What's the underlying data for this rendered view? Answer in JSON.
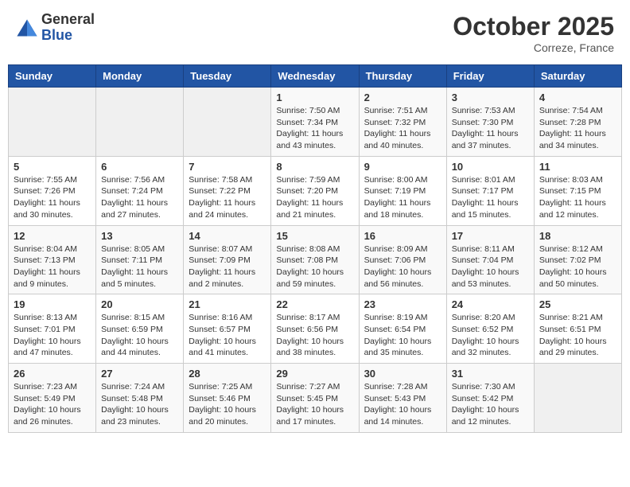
{
  "header": {
    "logo_line1": "General",
    "logo_line2": "Blue",
    "month": "October 2025",
    "location": "Correze, France"
  },
  "days_of_week": [
    "Sunday",
    "Monday",
    "Tuesday",
    "Wednesday",
    "Thursday",
    "Friday",
    "Saturday"
  ],
  "weeks": [
    [
      {
        "day": "",
        "info": ""
      },
      {
        "day": "",
        "info": ""
      },
      {
        "day": "",
        "info": ""
      },
      {
        "day": "1",
        "info": "Sunrise: 7:50 AM\nSunset: 7:34 PM\nDaylight: 11 hours and 43 minutes."
      },
      {
        "day": "2",
        "info": "Sunrise: 7:51 AM\nSunset: 7:32 PM\nDaylight: 11 hours and 40 minutes."
      },
      {
        "day": "3",
        "info": "Sunrise: 7:53 AM\nSunset: 7:30 PM\nDaylight: 11 hours and 37 minutes."
      },
      {
        "day": "4",
        "info": "Sunrise: 7:54 AM\nSunset: 7:28 PM\nDaylight: 11 hours and 34 minutes."
      }
    ],
    [
      {
        "day": "5",
        "info": "Sunrise: 7:55 AM\nSunset: 7:26 PM\nDaylight: 11 hours and 30 minutes."
      },
      {
        "day": "6",
        "info": "Sunrise: 7:56 AM\nSunset: 7:24 PM\nDaylight: 11 hours and 27 minutes."
      },
      {
        "day": "7",
        "info": "Sunrise: 7:58 AM\nSunset: 7:22 PM\nDaylight: 11 hours and 24 minutes."
      },
      {
        "day": "8",
        "info": "Sunrise: 7:59 AM\nSunset: 7:20 PM\nDaylight: 11 hours and 21 minutes."
      },
      {
        "day": "9",
        "info": "Sunrise: 8:00 AM\nSunset: 7:19 PM\nDaylight: 11 hours and 18 minutes."
      },
      {
        "day": "10",
        "info": "Sunrise: 8:01 AM\nSunset: 7:17 PM\nDaylight: 11 hours and 15 minutes."
      },
      {
        "day": "11",
        "info": "Sunrise: 8:03 AM\nSunset: 7:15 PM\nDaylight: 11 hours and 12 minutes."
      }
    ],
    [
      {
        "day": "12",
        "info": "Sunrise: 8:04 AM\nSunset: 7:13 PM\nDaylight: 11 hours and 9 minutes."
      },
      {
        "day": "13",
        "info": "Sunrise: 8:05 AM\nSunset: 7:11 PM\nDaylight: 11 hours and 5 minutes."
      },
      {
        "day": "14",
        "info": "Sunrise: 8:07 AM\nSunset: 7:09 PM\nDaylight: 11 hours and 2 minutes."
      },
      {
        "day": "15",
        "info": "Sunrise: 8:08 AM\nSunset: 7:08 PM\nDaylight: 10 hours and 59 minutes."
      },
      {
        "day": "16",
        "info": "Sunrise: 8:09 AM\nSunset: 7:06 PM\nDaylight: 10 hours and 56 minutes."
      },
      {
        "day": "17",
        "info": "Sunrise: 8:11 AM\nSunset: 7:04 PM\nDaylight: 10 hours and 53 minutes."
      },
      {
        "day": "18",
        "info": "Sunrise: 8:12 AM\nSunset: 7:02 PM\nDaylight: 10 hours and 50 minutes."
      }
    ],
    [
      {
        "day": "19",
        "info": "Sunrise: 8:13 AM\nSunset: 7:01 PM\nDaylight: 10 hours and 47 minutes."
      },
      {
        "day": "20",
        "info": "Sunrise: 8:15 AM\nSunset: 6:59 PM\nDaylight: 10 hours and 44 minutes."
      },
      {
        "day": "21",
        "info": "Sunrise: 8:16 AM\nSunset: 6:57 PM\nDaylight: 10 hours and 41 minutes."
      },
      {
        "day": "22",
        "info": "Sunrise: 8:17 AM\nSunset: 6:56 PM\nDaylight: 10 hours and 38 minutes."
      },
      {
        "day": "23",
        "info": "Sunrise: 8:19 AM\nSunset: 6:54 PM\nDaylight: 10 hours and 35 minutes."
      },
      {
        "day": "24",
        "info": "Sunrise: 8:20 AM\nSunset: 6:52 PM\nDaylight: 10 hours and 32 minutes."
      },
      {
        "day": "25",
        "info": "Sunrise: 8:21 AM\nSunset: 6:51 PM\nDaylight: 10 hours and 29 minutes."
      }
    ],
    [
      {
        "day": "26",
        "info": "Sunrise: 7:23 AM\nSunset: 5:49 PM\nDaylight: 10 hours and 26 minutes."
      },
      {
        "day": "27",
        "info": "Sunrise: 7:24 AM\nSunset: 5:48 PM\nDaylight: 10 hours and 23 minutes."
      },
      {
        "day": "28",
        "info": "Sunrise: 7:25 AM\nSunset: 5:46 PM\nDaylight: 10 hours and 20 minutes."
      },
      {
        "day": "29",
        "info": "Sunrise: 7:27 AM\nSunset: 5:45 PM\nDaylight: 10 hours and 17 minutes."
      },
      {
        "day": "30",
        "info": "Sunrise: 7:28 AM\nSunset: 5:43 PM\nDaylight: 10 hours and 14 minutes."
      },
      {
        "day": "31",
        "info": "Sunrise: 7:30 AM\nSunset: 5:42 PM\nDaylight: 10 hours and 12 minutes."
      },
      {
        "day": "",
        "info": ""
      }
    ]
  ]
}
